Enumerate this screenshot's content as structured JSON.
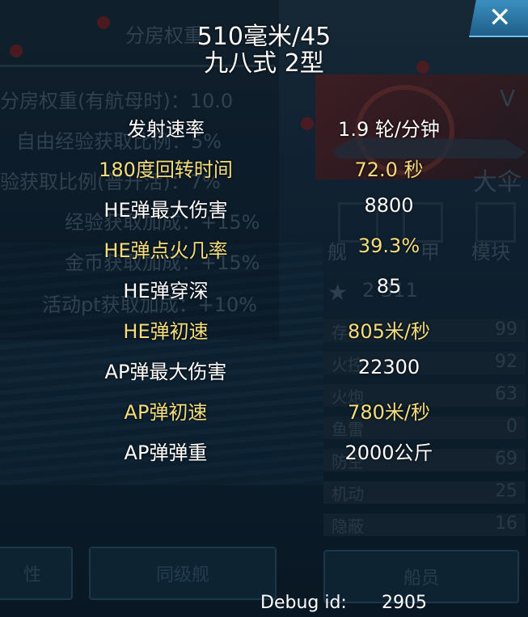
{
  "window": {
    "title_line1": "510毫米/45",
    "title_line2": "九八式 2型",
    "close_glyph": "✕"
  },
  "stats": [
    {
      "label": "发射速率",
      "value": "1.9 轮/分钟",
      "color": "#ffffff"
    },
    {
      "label": "180度回转时间",
      "value": "72.0 秒",
      "color": "#f3dd7c"
    },
    {
      "label": "HE弹最大伤害",
      "value": "8800",
      "color": "#ffffff"
    },
    {
      "label": "HE弹点火几率",
      "value": "39.3%",
      "color": "#f3dd7c"
    },
    {
      "label": "HE弹穿深",
      "value": "85",
      "color": "#ffffff"
    },
    {
      "label": "HE弹初速",
      "value": "805米/秒",
      "color": "#f3dd7c"
    },
    {
      "label": "AP弹最大伤害",
      "value": "22300",
      "color": "#ffffff"
    },
    {
      "label": "AP弹初速",
      "value": "780米/秒",
      "color": "#f3dd7c"
    },
    {
      "label": "AP弹弹重",
      "value": "2000公斤",
      "color": "#ffffff"
    }
  ],
  "debug": {
    "label": "Debug id:",
    "value": "2905"
  },
  "background": {
    "left_stats": [
      "分房权重",
      "分房权重(有航母时)：10.0",
      "自由经验获取比例：5%",
      "验获取比例(普升活)：7%",
      "经验获取加成：+15%",
      "金币获取加成：+15%",
      "活动pt获取加成：+10%"
    ],
    "right_header_letter": "V",
    "ship_name_partial": "大伞",
    "tabs": [
      "舰",
      "甲",
      "模块"
    ],
    "score_partial": "2  311",
    "attr_rows": [
      {
        "label": "存",
        "value": "99"
      },
      {
        "label": "火控",
        "value": "92"
      },
      {
        "label": "火炮",
        "value": "63"
      },
      {
        "label": "鱼雷",
        "value": "0"
      },
      {
        "label": "防空",
        "value": "69"
      },
      {
        "label": "机动",
        "value": "25"
      },
      {
        "label": "隐蔽",
        "value": "16"
      }
    ],
    "buttons": {
      "left_partial": "性",
      "same_tier": "同级舰",
      "crew": "船员"
    }
  }
}
